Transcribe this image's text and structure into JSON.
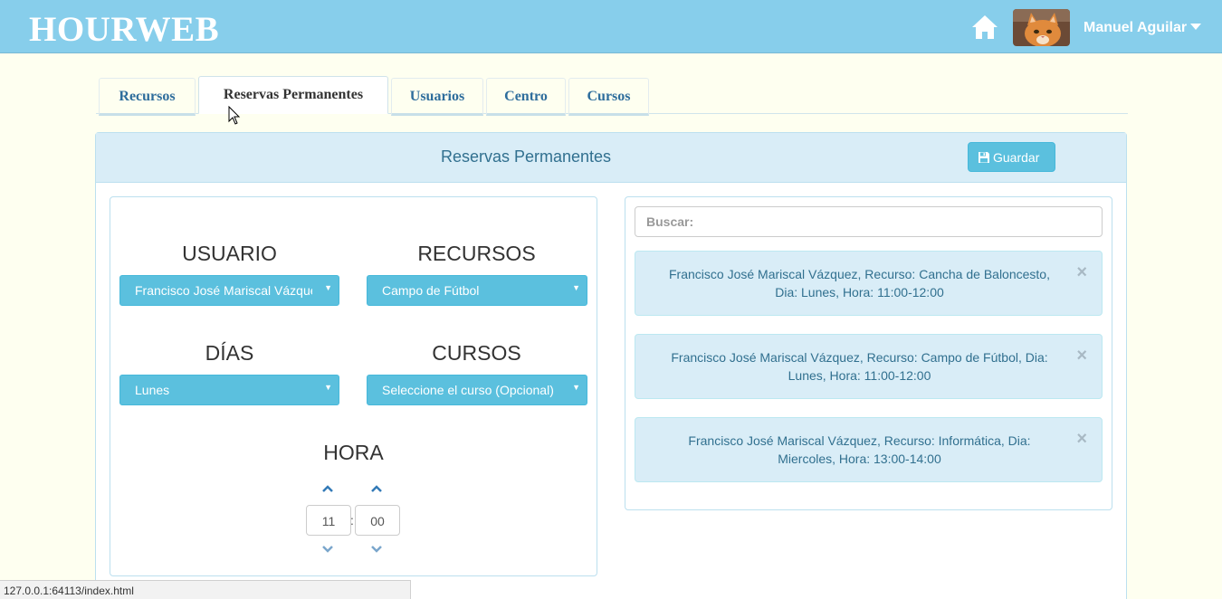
{
  "navbar": {
    "brand": "HOURWEB",
    "home_icon": "home-icon",
    "avatar": "cat-avatar",
    "user_name": "Manuel Aguilar"
  },
  "tabs": [
    {
      "label": "Recursos",
      "active": false
    },
    {
      "label": "Reservas Permanentes",
      "active": true
    },
    {
      "label": "Usuarios",
      "active": false
    },
    {
      "label": "Centro",
      "active": false
    },
    {
      "label": "Cursos",
      "active": false
    }
  ],
  "panel": {
    "title": "Reservas Permanentes",
    "save_label": "Guardar",
    "save_icon": "save-icon"
  },
  "form": {
    "usuario_label": "USUARIO",
    "usuario_value": "Francisco José Mariscal Vázquez",
    "recursos_label": "RECURSOS",
    "recursos_value": "Campo de Fútbol",
    "dias_label": "DÍAS",
    "dias_value": "Lunes",
    "cursos_label": "CURSOS",
    "cursos_value": "Seleccione el curso (Opcional)",
    "hora_label": "HORA",
    "hour": "11",
    "minute": "00",
    "separator": ":"
  },
  "search": {
    "placeholder": "Buscar:"
  },
  "reservations": [
    {
      "line1": "Francisco José Mariscal Vázquez, Recurso: Cancha de Baloncesto,",
      "line2": "Dia: Lunes, Hora: 11:00-12:00"
    },
    {
      "line1": "Francisco José Mariscal Vázquez, Recurso: Campo de Fútbol, Dia:",
      "line2": "Lunes, Hora: 11:00-12:00"
    },
    {
      "line1": "Francisco José Mariscal Vázquez, Recurso: Informática, Dia:",
      "line2": "Miercoles, Hora: 13:00-14:00"
    }
  ],
  "close_glyph": "×",
  "status_url": "127.0.0.1:64113/index.html",
  "colors": {
    "navbar": "#87ceeb",
    "background": "#fefff0",
    "info_button": "#5bc0de",
    "alert_bg": "#d9edf7",
    "link": "#2e6d9c"
  }
}
